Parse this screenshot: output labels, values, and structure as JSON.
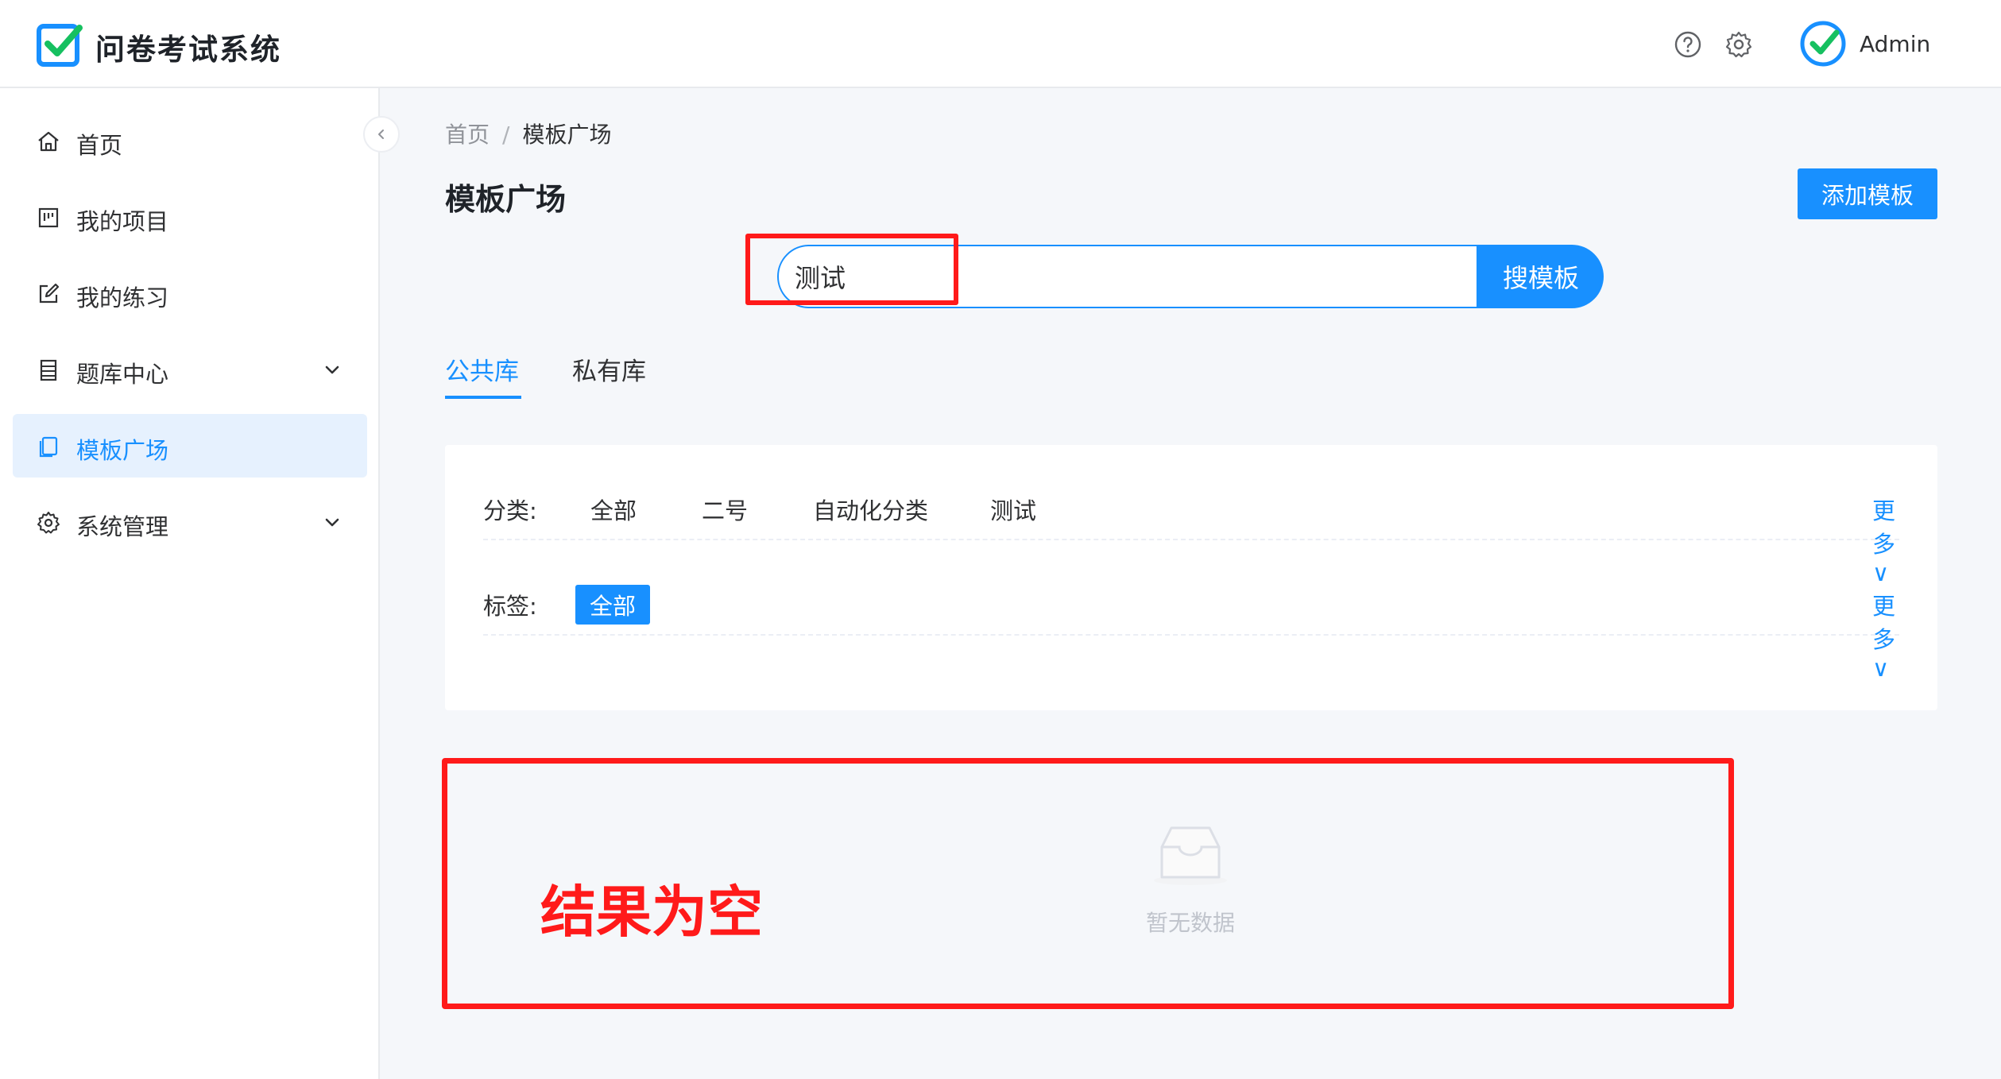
{
  "app": {
    "title": "问卷考试系统"
  },
  "header": {
    "user": "Admin",
    "icons": [
      "help-icon",
      "gear-icon"
    ]
  },
  "sidebar": {
    "items": [
      {
        "label": "首页",
        "icon": "home-icon"
      },
      {
        "label": "我的项目",
        "icon": "project-icon"
      },
      {
        "label": "我的练习",
        "icon": "edit-icon"
      },
      {
        "label": "题库中心",
        "icon": "list-icon",
        "expandable": true
      },
      {
        "label": "模板广场",
        "icon": "template-icon",
        "active": true
      },
      {
        "label": "系统管理",
        "icon": "gear-icon",
        "expandable": true
      }
    ]
  },
  "breadcrumb": {
    "home": "首页",
    "sep": "/",
    "current": "模板广场"
  },
  "page": {
    "title": "模板广场",
    "add_button": "添加模板"
  },
  "search": {
    "value": "测试",
    "button": "搜模板"
  },
  "tabs": [
    {
      "label": "公共库",
      "active": true
    },
    {
      "label": "私有库"
    }
  ],
  "filters": {
    "category": {
      "label": "分类:",
      "options": [
        "全部",
        "二号",
        "自动化分类",
        "测试"
      ],
      "more": "更多∨"
    },
    "tag": {
      "label": "标签:",
      "options": [
        "全部"
      ],
      "more": "更多∨"
    }
  },
  "empty": {
    "text": "暂无数据"
  },
  "annotation": {
    "note": "结果为空"
  },
  "colors": {
    "primary": "#1890ff",
    "annotation": "#ff1a1a"
  }
}
